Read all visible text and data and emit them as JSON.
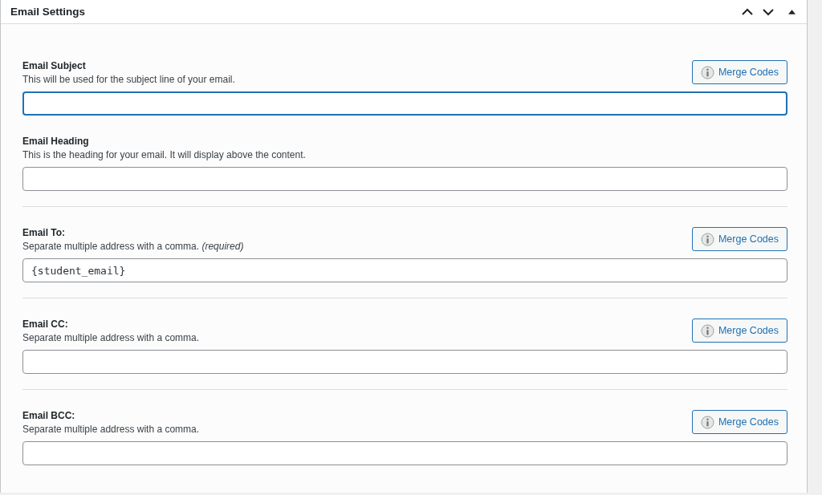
{
  "panel": {
    "title": "Email Settings"
  },
  "groups": [
    {
      "fields": [
        {
          "label": "Email Subject",
          "description": "This will be used for the subject line of your email.",
          "focused": true,
          "button": "Merge Codes"
        },
        {
          "label": "Email Heading",
          "description": "This is the heading for your email. It will display above the content.",
          "focused": false
        }
      ]
    },
    {
      "fields": [
        {
          "label": "Email To:",
          "description": "Separate multiple address with a comma. *(required)*",
          "value": "{student_email}",
          "focused": false,
          "button": "Merge Codes"
        }
      ]
    },
    {
      "fields": [
        {
          "label": "Email CC:",
          "description": "Separate multiple address with a comma.",
          "focused": false,
          "button": "Merge Codes"
        }
      ]
    },
    {
      "fields": [
        {
          "label": "Email BCC:",
          "description": "Separate multiple address with a comma.",
          "focused": false,
          "button": "Merge Codes"
        }
      ]
    }
  ]
}
